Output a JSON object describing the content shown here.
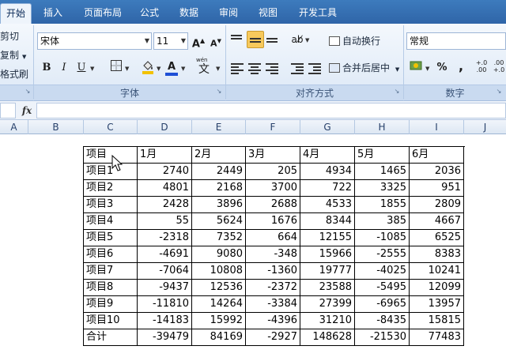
{
  "tabs": [
    "开始",
    "插入",
    "页面布局",
    "公式",
    "数据",
    "审阅",
    "视图",
    "开发工具"
  ],
  "clipboard": {
    "cut": "剪切",
    "copy": "复制",
    "format_painter": "格式刷"
  },
  "font": {
    "name": "宋体",
    "size": "11",
    "grow_label": "A",
    "shrink_label": "A",
    "bold": "B",
    "italic": "I",
    "underline": "U",
    "font_color_label": "A",
    "phonetic_label": "文",
    "phonetic_small": "wén",
    "group_label": "字体"
  },
  "alignment": {
    "wrap_text": "自动换行",
    "merge_center": "合并后居中",
    "group_label": "对齐方式"
  },
  "number": {
    "format": "常规",
    "percent": "%",
    "comma": ",",
    "inc_decimal": "+.0\n.00",
    "dec_decimal": ".00\n+.0",
    "group_label": "数字"
  },
  "formula_bar": {
    "fx": "fx"
  },
  "columns": [
    "A",
    "B",
    "C",
    "D",
    "E",
    "F",
    "G",
    "H",
    "I",
    "J"
  ],
  "table": {
    "header": [
      "项目",
      "1月",
      "2月",
      "3月",
      "4月",
      "5月",
      "6月"
    ],
    "rows": [
      [
        "项目1",
        "2740",
        "2449",
        "205",
        "4934",
        "1465",
        "2036"
      ],
      [
        "项目2",
        "4801",
        "2168",
        "3700",
        "722",
        "3325",
        "951"
      ],
      [
        "项目3",
        "2428",
        "3896",
        "2688",
        "4533",
        "1855",
        "2809"
      ],
      [
        "项目4",
        "55",
        "5624",
        "1676",
        "8344",
        "385",
        "4667"
      ],
      [
        "项目5",
        "-2318",
        "7352",
        "664",
        "12155",
        "-1085",
        "6525"
      ],
      [
        "项目6",
        "-4691",
        "9080",
        "-348",
        "15966",
        "-2555",
        "8383"
      ],
      [
        "项目7",
        "-7064",
        "10808",
        "-1360",
        "19777",
        "-4025",
        "10241"
      ],
      [
        "项目8",
        "-9437",
        "12536",
        "-2372",
        "23588",
        "-5495",
        "12099"
      ],
      [
        "项目9",
        "-11810",
        "14264",
        "-3384",
        "27399",
        "-6965",
        "13957"
      ],
      [
        "项目10",
        "-14183",
        "15992",
        "-4396",
        "31210",
        "-8435",
        "15815"
      ],
      [
        "合计",
        "-39479",
        "84169",
        "-2927",
        "148628",
        "-21530",
        "77483"
      ]
    ]
  },
  "colors": {
    "tab_bar": "#2f65a8",
    "ribbon": "#dce8f6",
    "pressed": "#f7c95c",
    "font_color": "#1e4fd6",
    "fill_color": "#f2c200"
  }
}
